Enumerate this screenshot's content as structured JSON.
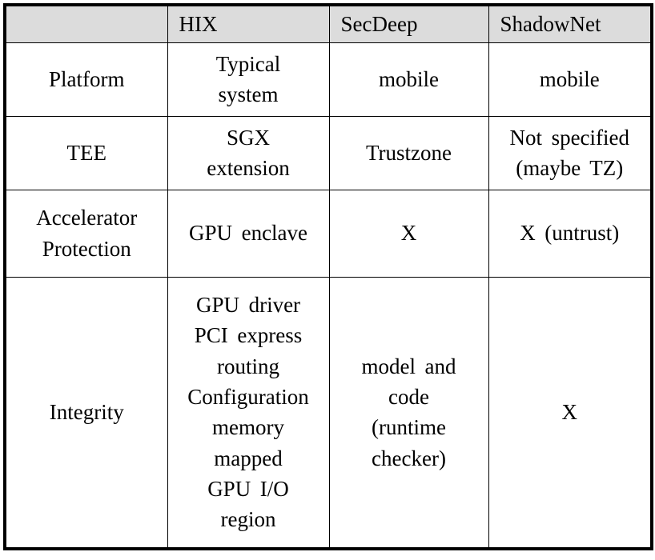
{
  "table": {
    "columns": [
      {
        "key": "rowlabel",
        "label": ""
      },
      {
        "key": "hix",
        "label": "HIX"
      },
      {
        "key": "secdeep",
        "label": "SecDeep"
      },
      {
        "key": "shadownet",
        "label": "ShadowNet"
      }
    ],
    "header_background": "#dcdcdc",
    "border_color": "#000000",
    "rows": [
      {
        "label": "Platform",
        "hix": [
          "Typical",
          "system"
        ],
        "secdeep": [
          "mobile"
        ],
        "shadownet": [
          "mobile"
        ]
      },
      {
        "label": "TEE",
        "hix": [
          "SGX",
          "extension"
        ],
        "secdeep": [
          "Trustzone"
        ],
        "shadownet": [
          "Not specified",
          "(maybe TZ)"
        ]
      },
      {
        "label": "Accelerator Protection",
        "label_lines": [
          "Accelerator",
          "Protection"
        ],
        "hix": [
          "GPU enclave"
        ],
        "secdeep": [
          "X"
        ],
        "shadownet": [
          "X (untrust)"
        ]
      },
      {
        "label": "Integrity",
        "hix": [
          "GPU driver",
          "PCI express",
          "routing",
          "Configuration",
          "memory",
          "mapped",
          "GPU I/O",
          "region"
        ],
        "secdeep": [
          "model and",
          "code",
          "(runtime",
          "checker)"
        ],
        "shadownet": [
          "X"
        ]
      }
    ]
  }
}
